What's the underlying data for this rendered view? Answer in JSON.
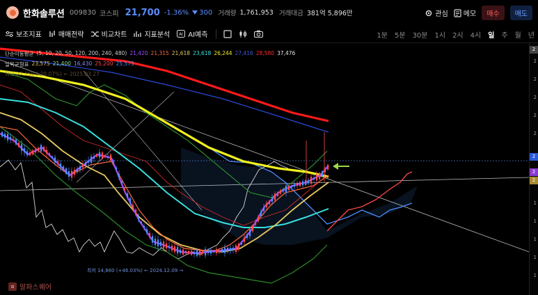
{
  "header": {
    "stock_name": "한화솔루션",
    "stock_code": "009830",
    "market": "코스피",
    "price": "21,700",
    "change_pct": "-1.36%",
    "change_abs": "300",
    "volume_label": "거래량",
    "volume_value": "1,761,953",
    "amount_label": "거래대금",
    "amount_value": "381억 5,896만",
    "watch_label": "관심",
    "memo_label": "메모",
    "buy_label": "매수",
    "sell_label": "매도"
  },
  "toolbar": {
    "items": [
      "보조지표",
      "매매전략",
      "비교차트",
      "지표분석",
      "AI예측"
    ],
    "periods": [
      "1분",
      "5분",
      "30분",
      "1시",
      "2시",
      "4시",
      "일",
      "주",
      "월",
      "년"
    ],
    "active_period": "일"
  },
  "legend": {
    "ma_title": "단순이동평균",
    "ma_params": "(5, 10, 20, 50, 120, 200, 240, 480)",
    "ma_values": [
      {
        "v": "21,420",
        "color": "#a24cff"
      },
      {
        "v": "21,315",
        "color": "#ff6a3a"
      },
      {
        "v": "21,618",
        "color": "#e8c860"
      },
      {
        "v": "23,618",
        "color": "#37e0e0"
      },
      {
        "v": "26,244",
        "color": "#f0f020"
      },
      {
        "v": "27,416",
        "color": "#3a5ad8"
      },
      {
        "v": "28,580",
        "color": "#ff2a2a"
      },
      {
        "v": "37,476",
        "color": "#e6e6e6"
      }
    ],
    "ichi_title": "일목균형표",
    "ichi_values": [
      {
        "v": "23,575",
        "color": "#e8c860"
      },
      {
        "v": "21,400",
        "color": "#8fe08f"
      },
      {
        "v": "16,430",
        "color": "#8c8cff"
      },
      {
        "v": "25,200",
        "color": "#ff4a4a"
      },
      {
        "v": "25,575",
        "color": "#4a90ff"
      }
    ],
    "line3_text": "최고 27,150 (-20.07%) ← 2025.03.27"
  },
  "low_label": "최저 14,860 (+46.03%) ← 2024.12.09 →",
  "watermark": "알파스퀘어",
  "colors": {
    "up": "#ff4a4a",
    "down": "#4a90ff",
    "ma5": "#a24cff",
    "ma20": "#e8c860",
    "ma50": "#37e0e0",
    "ma120": "#f0f020",
    "ma200": "#3a5ad8",
    "ma240": "#ff2a2a",
    "bollinger": "#2b8a2b",
    "cloud_line": "#4a90ff",
    "arrow": "#9ad94a"
  }
}
